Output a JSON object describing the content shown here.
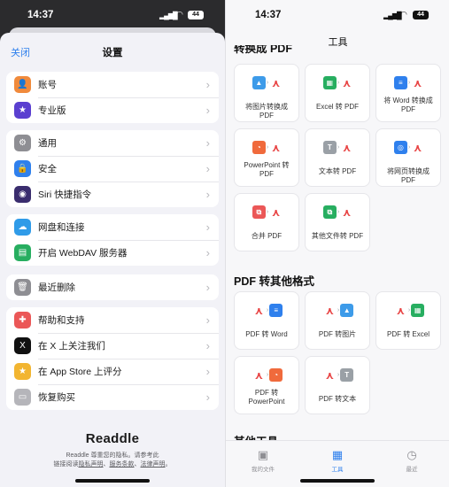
{
  "left": {
    "status": {
      "time": "14:37",
      "battery": "44"
    },
    "header": {
      "close": "关闭",
      "title": "设置"
    },
    "groups": [
      [
        {
          "label": "账号",
          "icon": "person-icon",
          "color": "#f08a3c",
          "glyph": "👤"
        },
        {
          "label": "专业版",
          "icon": "star-icon",
          "color": "#5a3fd0",
          "glyph": "★"
        }
      ],
      [
        {
          "label": "通用",
          "icon": "gear-icon",
          "color": "#8e8e93",
          "glyph": "⚙"
        },
        {
          "label": "安全",
          "icon": "lock-icon",
          "color": "#2f80ed",
          "glyph": "🔒"
        },
        {
          "label": "Siri 快捷指令",
          "icon": "siri-icon",
          "color": "#3a2d6e",
          "glyph": "◉"
        }
      ],
      [
        {
          "label": "网盘和连接",
          "icon": "cloud-icon",
          "color": "#2f9be8",
          "glyph": "☁"
        },
        {
          "label": "开启 WebDAV 服务器",
          "icon": "server-icon",
          "color": "#27ae60",
          "glyph": "▤"
        }
      ],
      [
        {
          "label": "最近删除",
          "icon": "trash-icon",
          "color": "#8e8e93",
          "glyph": "🗑"
        }
      ],
      [
        {
          "label": "帮助和支持",
          "icon": "lifebuoy-icon",
          "color": "#eb5757",
          "glyph": "✚"
        },
        {
          "label": "在 X 上关注我们",
          "icon": "x-icon",
          "color": "#111111",
          "glyph": "X"
        },
        {
          "label": "在 App Store 上评分",
          "icon": "rating-star-icon",
          "color": "#f2b531",
          "glyph": "★"
        },
        {
          "label": "恢复购买",
          "icon": "purchase-icon",
          "color": "#b5b5ba",
          "glyph": "▭"
        }
      ]
    ],
    "brand": "Readdle",
    "privacy_line1": "Readdle 尊重您的隐私。请参考此",
    "privacy_line2_prefix": "链接阅读",
    "privacy_link1": "隐私声明",
    "privacy_sep": "、",
    "privacy_link2": "服务条款",
    "privacy_sep2": "、",
    "privacy_link3": "法律声明",
    "privacy_end": "。"
  },
  "right": {
    "status": {
      "time": "14:37",
      "battery": "44"
    },
    "nav_title": "工具",
    "section1_partial": "转换成 PDF",
    "to_pdf": [
      {
        "label": "将图片转换成 PDF",
        "src_icon": "image-icon",
        "src_color": "#3d9be9",
        "glyph": "▲"
      },
      {
        "label": "Excel 转 PDF",
        "src_icon": "spreadsheet-icon",
        "src_color": "#27ae60",
        "glyph": "▦"
      },
      {
        "label": "将 Word 转换成 PDF",
        "src_icon": "document-icon",
        "src_color": "#2f80ed",
        "glyph": "≡"
      },
      {
        "label": "PowerPoint 转 PDF",
        "src_icon": "presentation-icon",
        "src_color": "#f06a3c",
        "glyph": "◔"
      },
      {
        "label": "文本转 PDF",
        "src_icon": "text-icon",
        "src_color": "#9aa0a6",
        "glyph": "T"
      },
      {
        "label": "将网页转换成 PDF",
        "src_icon": "compass-icon",
        "src_color": "#2f80ed",
        "glyph": "◎"
      },
      {
        "label": "合并 PDF",
        "src_icon": "merge-icon",
        "src_color": "#eb5757",
        "glyph": "⧉"
      },
      {
        "label": "其他文件转 PDF",
        "src_icon": "files-icon",
        "src_color": "#27ae60",
        "glyph": "⧉"
      }
    ],
    "section2": "PDF 转其他格式",
    "from_pdf": [
      {
        "label": "PDF 转 Word",
        "dst_icon": "document-icon",
        "dst_color": "#2f80ed",
        "glyph": "≡"
      },
      {
        "label": "PDF 转图片",
        "dst_icon": "image-icon",
        "dst_color": "#3d9be9",
        "glyph": "▲"
      },
      {
        "label": "PDF 转 Excel",
        "dst_icon": "spreadsheet-icon",
        "dst_color": "#27ae60",
        "glyph": "▦"
      },
      {
        "label": "PDF 转 PowerPoint",
        "dst_icon": "presentation-icon",
        "dst_color": "#f06a3c",
        "glyph": "◔"
      },
      {
        "label": "PDF 转文本",
        "dst_icon": "text-icon",
        "dst_color": "#9aa0a6",
        "glyph": "T"
      }
    ],
    "section3": "其他工具",
    "tabs": [
      {
        "label": "我的文件",
        "icon": "folder-icon",
        "glyph": "▣",
        "active": false
      },
      {
        "label": "工具",
        "icon": "tools-icon",
        "glyph": "▦",
        "active": true
      },
      {
        "label": "最近",
        "icon": "clock-icon",
        "glyph": "◷",
        "active": false
      }
    ]
  }
}
